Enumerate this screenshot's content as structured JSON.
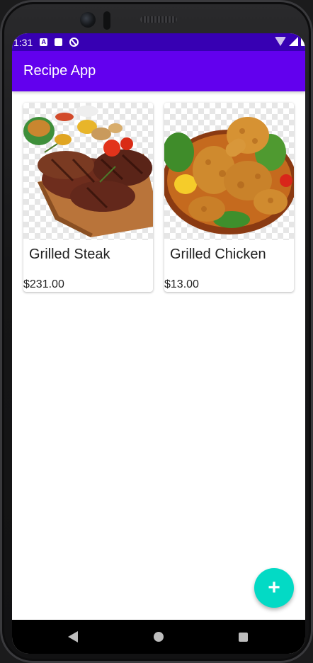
{
  "status_bar": {
    "time": "1:31",
    "icons": [
      "a-icon",
      "sd-card-icon",
      "do-not-disturb-icon"
    ],
    "right_icons": [
      "wifi-icon",
      "signal-icon",
      "battery-icon"
    ]
  },
  "app_bar": {
    "title": "Recipe App"
  },
  "recipes": [
    {
      "name": "Grilled Steak",
      "price": "$231.00",
      "image": "grilled-steak-image"
    },
    {
      "name": "Grilled Chicken",
      "price": "$13.00",
      "image": "grilled-chicken-image"
    }
  ],
  "fab": {
    "icon": "add-icon",
    "glyph": "+"
  },
  "nav_bar": [
    "back-icon",
    "home-icon",
    "recents-icon"
  ],
  "colors": {
    "status_bar": "#3700b3",
    "app_bar": "#6200ee",
    "fab": "#03dac5"
  }
}
